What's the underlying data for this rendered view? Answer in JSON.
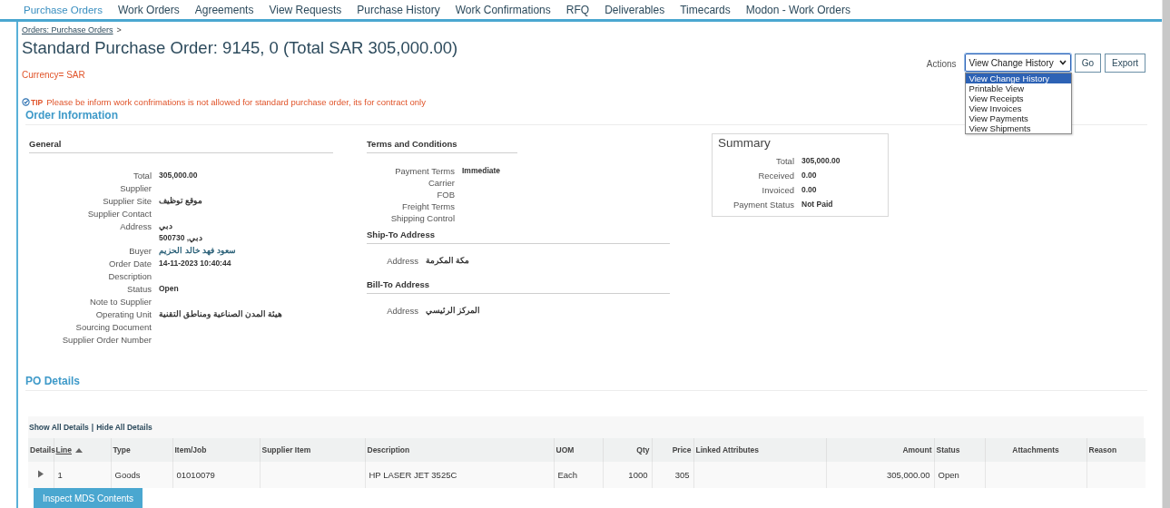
{
  "tabs": [
    {
      "label": "Purchase Orders",
      "selected": true
    },
    {
      "label": "Work Orders",
      "selected": false
    },
    {
      "label": "Agreements",
      "selected": false
    },
    {
      "label": "View Requests",
      "selected": false
    },
    {
      "label": "Purchase History",
      "selected": false
    },
    {
      "label": "Work Confirmations",
      "selected": false
    },
    {
      "label": "RFQ",
      "selected": false
    },
    {
      "label": "Deliverables",
      "selected": false
    },
    {
      "label": "Timecards",
      "selected": false
    },
    {
      "label": "Modon - Work Orders",
      "selected": false
    }
  ],
  "breadcrumb": {
    "link": "Orders: Purchase Orders",
    "separator": ">"
  },
  "title": "Standard Purchase Order: 9145, 0 (Total SAR 305,000.00)",
  "currency": "Currency= SAR",
  "actions": {
    "label": "Actions",
    "value": "View Change History",
    "expanded": true,
    "options": [
      {
        "label": "View Change History",
        "selected": true
      },
      {
        "label": "Printable View",
        "selected": false
      },
      {
        "label": "View Receipts",
        "selected": false
      },
      {
        "label": "View Invoices",
        "selected": false
      },
      {
        "label": "View Payments",
        "selected": false
      },
      {
        "label": "View Shipments",
        "selected": false
      }
    ],
    "buttons": [
      "Go",
      "Export"
    ]
  },
  "tip": {
    "label": "TIP",
    "text": "Please be inform work confrimations is not allowed for standard purchase order, its for contract only"
  },
  "order_information": {
    "heading": "Order Information",
    "general": {
      "heading": "General",
      "fields": [
        {
          "label": "Total",
          "value": "305,000.00",
          "kind": "bold"
        },
        {
          "label": "Supplier"
        },
        {
          "label": "Supplier Site",
          "value": "موقع توظيف",
          "kind": "bold"
        },
        {
          "label": "Supplier Contact"
        },
        {
          "label": "Address",
          "lines": [
            "دبي",
            "دبي, 500730"
          ],
          "kind": "bold"
        },
        {
          "label": "Buyer",
          "value": "سعود فهد خالد الحزيم",
          "kind": "link"
        },
        {
          "label": "Order Date",
          "value": "14-11-2023 10:40:44",
          "kind": "bold"
        },
        {
          "label": "Description"
        },
        {
          "label": "Status",
          "value": "Open",
          "kind": "bold"
        },
        {
          "label": "Note to Supplier"
        },
        {
          "label": "Operating Unit",
          "value": "هيئة المدن الصناعية ومناطق التقنية",
          "kind": "bold"
        },
        {
          "label": "Sourcing Document"
        },
        {
          "label": "Supplier Order Number"
        }
      ]
    },
    "terms": {
      "heading": "Terms and Conditions",
      "fields": [
        {
          "label": "Payment Terms",
          "value": "Immediate"
        },
        {
          "label": "Carrier"
        },
        {
          "label": "FOB"
        },
        {
          "label": "Freight Terms"
        },
        {
          "label": "Shipping Control"
        }
      ]
    },
    "ship_to": {
      "heading": "Ship-To Address",
      "fields": [
        {
          "label": "Address",
          "value": "مكة المكرمة"
        }
      ]
    },
    "bill_to": {
      "heading": "Bill-To Address",
      "fields": [
        {
          "label": "Address",
          "value": "المركز الرئيسي"
        }
      ]
    },
    "summary": {
      "heading": "Summary",
      "fields": [
        {
          "label": "Total",
          "value": "305,000.00"
        },
        {
          "label": "Received",
          "value": "0.00"
        },
        {
          "label": "Invoiced",
          "value": "0.00"
        },
        {
          "label": "Payment Status",
          "value": "Not Paid"
        }
      ]
    }
  },
  "po_details": {
    "heading": "PO Details",
    "show_all": "Show All Details",
    "separator": "|",
    "hide_all": "Hide All Details",
    "table": {
      "columns": [
        {
          "label": "Details",
          "sorted": false
        },
        {
          "label": "Line",
          "sorted": true
        },
        {
          "label": "Type",
          "sorted": false
        },
        {
          "label": "Item/Job",
          "sorted": false
        },
        {
          "label": "Supplier Item",
          "sorted": false
        },
        {
          "label": "Description",
          "sorted": false
        },
        {
          "label": "UOM",
          "sorted": false
        },
        {
          "label": "Qty",
          "sorted": false
        },
        {
          "label": "Price",
          "sorted": false
        },
        {
          "label": "Linked Attributes",
          "sorted": false
        },
        {
          "label": "Amount",
          "sorted": false
        },
        {
          "label": "Status",
          "sorted": false
        },
        {
          "label": "Attachments",
          "sorted": false
        },
        {
          "label": "Reason",
          "sorted": false
        }
      ],
      "rows": [
        {
          "expanded": false,
          "cells": [
            "",
            "1",
            "Goods",
            "01010079",
            "",
            "HP LASER JET 3525C",
            "Each",
            "1000",
            "305",
            "",
            "305,000.00",
            "Open",
            "",
            ""
          ]
        }
      ]
    },
    "button": "Inspect MDS Contents"
  }
}
